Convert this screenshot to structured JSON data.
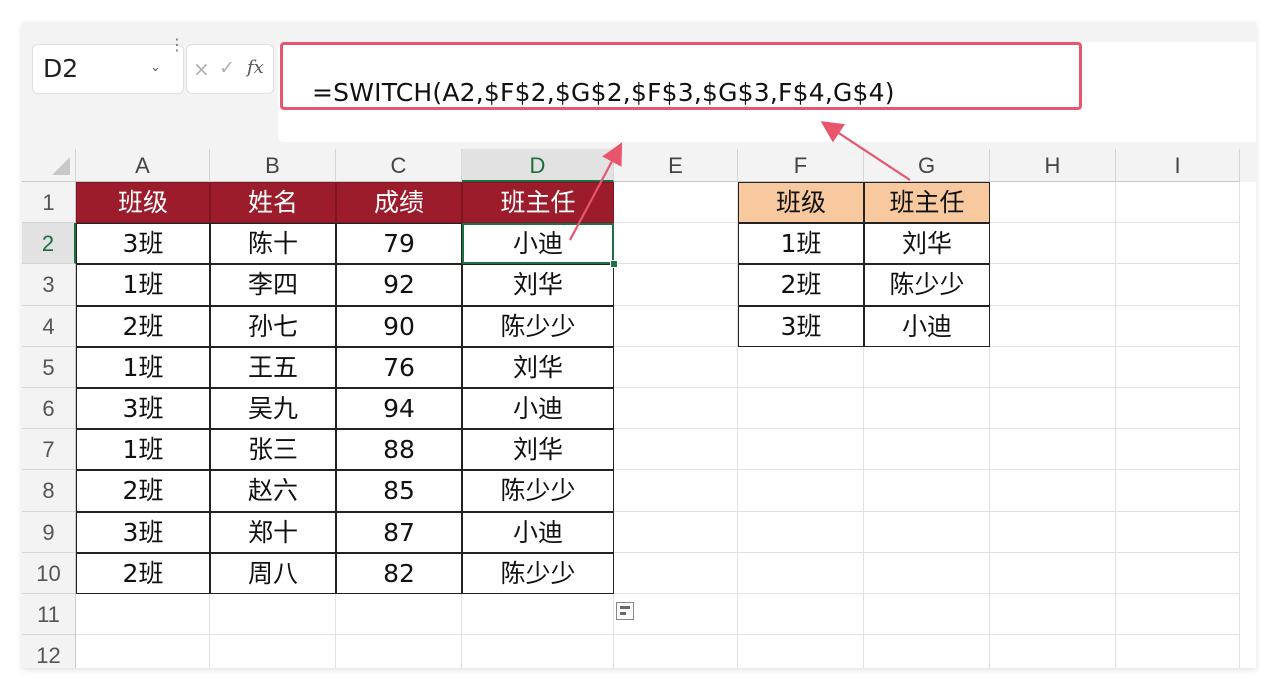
{
  "name_box": {
    "value": "D2"
  },
  "formula_bar": {
    "cancel_symbol": "×",
    "confirm_symbol": "✓",
    "fx_label": "fx",
    "formula": "=SWITCH(A2,$F$2,$G$2,$F$3,$G$3,F$4,G$4)"
  },
  "columns": [
    "A",
    "B",
    "C",
    "D",
    "E",
    "F",
    "G",
    "H",
    "I"
  ],
  "rows": [
    "1",
    "2",
    "3",
    "4",
    "5",
    "6",
    "7",
    "8",
    "9",
    "10",
    "11",
    "12"
  ],
  "main_table": {
    "headers": [
      "班级",
      "姓名",
      "成绩",
      "班主任"
    ],
    "rows": [
      [
        "3班",
        "陈十",
        "79",
        "小迪"
      ],
      [
        "1班",
        "李四",
        "92",
        "刘华"
      ],
      [
        "2班",
        "孙七",
        "90",
        "陈少少"
      ],
      [
        "1班",
        "王五",
        "76",
        "刘华"
      ],
      [
        "3班",
        "吴九",
        "94",
        "小迪"
      ],
      [
        "1班",
        "张三",
        "88",
        "刘华"
      ],
      [
        "2班",
        "赵六",
        "85",
        "陈少少"
      ],
      [
        "3班",
        "郑十",
        "87",
        "小迪"
      ],
      [
        "2班",
        "周八",
        "82",
        "陈少少"
      ]
    ]
  },
  "lookup_table": {
    "headers": [
      "班级",
      "班主任"
    ],
    "rows": [
      [
        "1班",
        "刘华"
      ],
      [
        "2班",
        "陈少少"
      ],
      [
        "3班",
        "小迪"
      ]
    ]
  },
  "colors": {
    "main_header_bg": "#9c1c2b",
    "lookup_header_bg": "#f8c99e",
    "highlight_border": "#e8566d",
    "selection": "#1e7145"
  }
}
